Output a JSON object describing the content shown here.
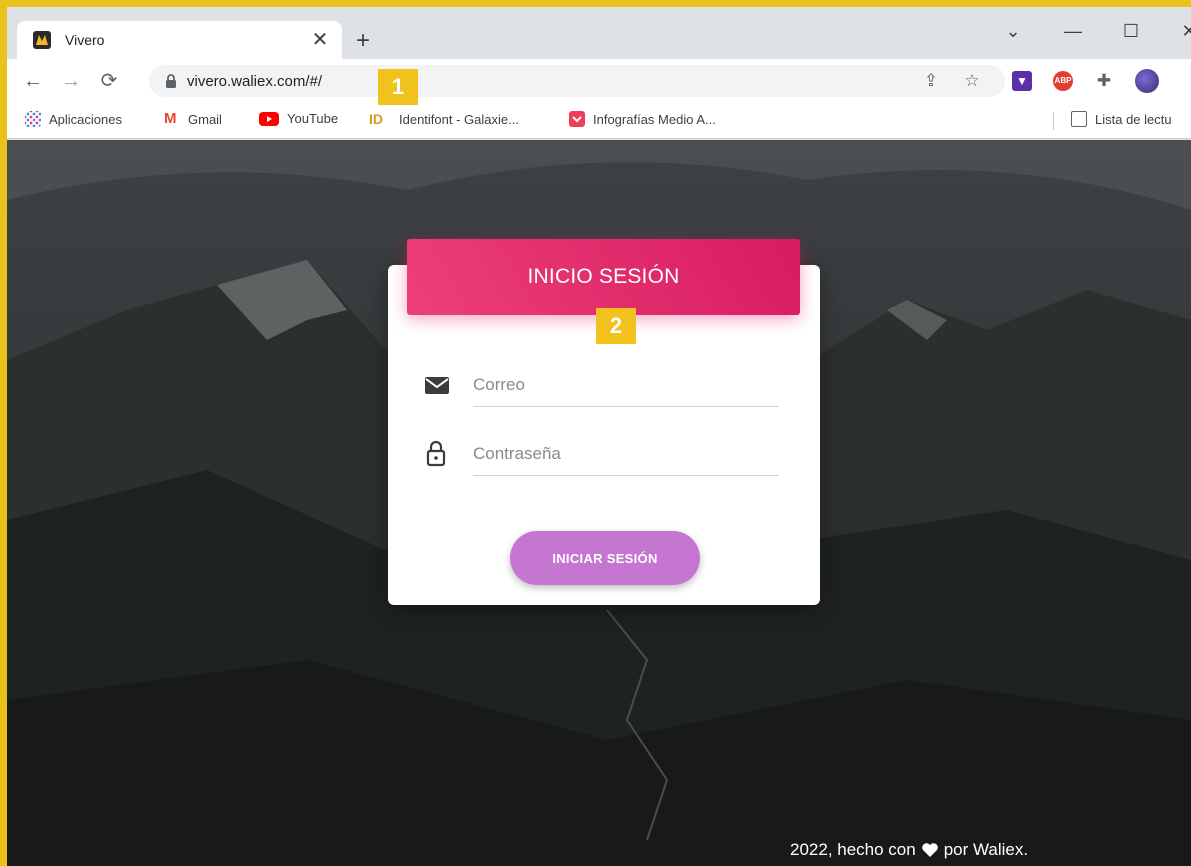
{
  "browser": {
    "tab": {
      "title": "Vivero",
      "close": "✕"
    },
    "new_tab": "+",
    "window": {
      "minimize": "—",
      "maximize": "☐",
      "close": "✕",
      "menu": "⌄"
    },
    "url": "vivero.waliex.com/#/",
    "bookmarks": [
      {
        "label": "Aplicaciones",
        "icon": "apps-grid-icon"
      },
      {
        "label": "Gmail",
        "icon": "gmail-icon"
      },
      {
        "label": "YouTube",
        "icon": "youtube-icon"
      },
      {
        "label": "Identifont - Galaxie...",
        "icon": "identifont-icon"
      },
      {
        "label": "Infografías Medio A...",
        "icon": "pocket-icon"
      }
    ],
    "reading_list": "Lista de lectu"
  },
  "annotations": {
    "badge1": "1",
    "badge2": "2"
  },
  "login": {
    "title": "INICIO SESIÓN",
    "email_placeholder": "Correo",
    "password_placeholder": "Contraseña",
    "submit_label": "INICIAR SESIÓN"
  },
  "footer": {
    "prefix": "2022, hecho con",
    "suffix": "por Waliex."
  },
  "colors": {
    "header_gradient_start": "#ec407a",
    "header_gradient_end": "#d81b60",
    "button": "#c476d0",
    "badge": "#f2c21c"
  }
}
